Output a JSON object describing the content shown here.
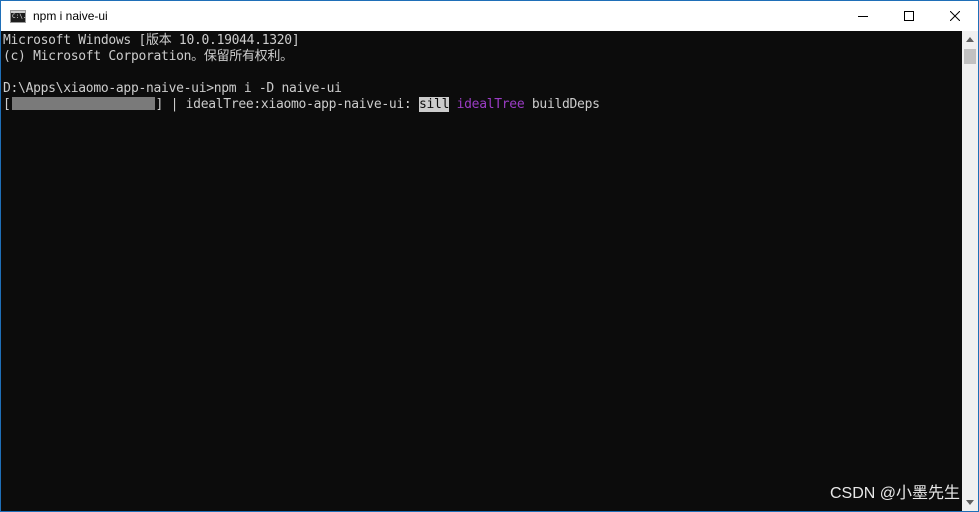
{
  "window": {
    "title": "npm i naive-ui",
    "icon_text": "C:\\.",
    "controls": {
      "minimize": "minimize-icon",
      "maximize": "maximize-icon",
      "close": "close-icon"
    }
  },
  "console": {
    "lines": [
      "Microsoft Windows [版本 10.0.19044.1320]",
      "(c) Microsoft Corporation。保留所有权利。",
      "",
      "D:\\Apps\\xiaomo-app-naive-ui>npm i -D naive-ui"
    ],
    "progress": {
      "open_bracket": "[",
      "close_bracket": "]",
      "fraction": 1.0,
      "separator": " | ",
      "stage": "idealTree:xiaomo-app-naive-ui: ",
      "level": "sill",
      "tag": "idealTree",
      "message": " buildDeps"
    }
  },
  "colors": {
    "background": "#0c0c0c",
    "foreground": "#cccccc",
    "tag": "#9a3cc4",
    "progress": "#7a7a7a",
    "border": "#1f6fb8"
  },
  "watermark": "CSDN @小墨先生"
}
